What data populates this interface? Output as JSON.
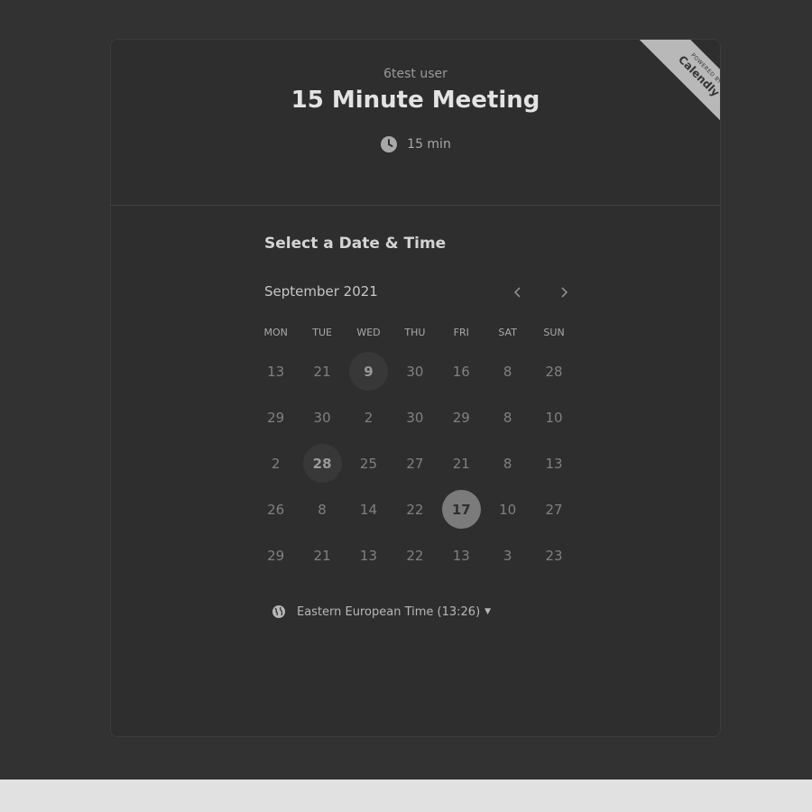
{
  "header": {
    "owner": "6test user",
    "title": "15 Minute Meeting",
    "duration": "15 min"
  },
  "ribbon": {
    "small": "POWERED BY",
    "brand": "Calendly"
  },
  "calendar": {
    "section_title": "Select a Date & Time",
    "month": "September 2021",
    "weekdays": [
      "MON",
      "TUE",
      "WED",
      "THU",
      "FRI",
      "SAT",
      "SUN"
    ],
    "weeks": [
      [
        "13",
        "21",
        "9",
        "30",
        "16",
        "8",
        "28"
      ],
      [
        "29",
        "30",
        "2",
        "30",
        "29",
        "8",
        "10"
      ],
      [
        "2",
        "28",
        "25",
        "27",
        "21",
        "8",
        "13"
      ],
      [
        "26",
        "8",
        "14",
        "22",
        "17",
        "10",
        "27"
      ],
      [
        "29",
        "21",
        "13",
        "22",
        "13",
        "3",
        "23"
      ]
    ],
    "available": [
      [
        0,
        2
      ],
      [
        2,
        1
      ]
    ],
    "selected": [
      3,
      4
    ]
  },
  "timezone": {
    "label": "Eastern European Time (13:26)"
  },
  "icons": {
    "clock": "clock-icon",
    "globe": "globe-icon",
    "prev": "chevron-left-icon",
    "next": "chevron-right-icon"
  },
  "colors": {
    "background": "#323232",
    "card": "#2e2e2e",
    "selected": "#7b7b7b",
    "ribbon": "#b8b8b8"
  }
}
